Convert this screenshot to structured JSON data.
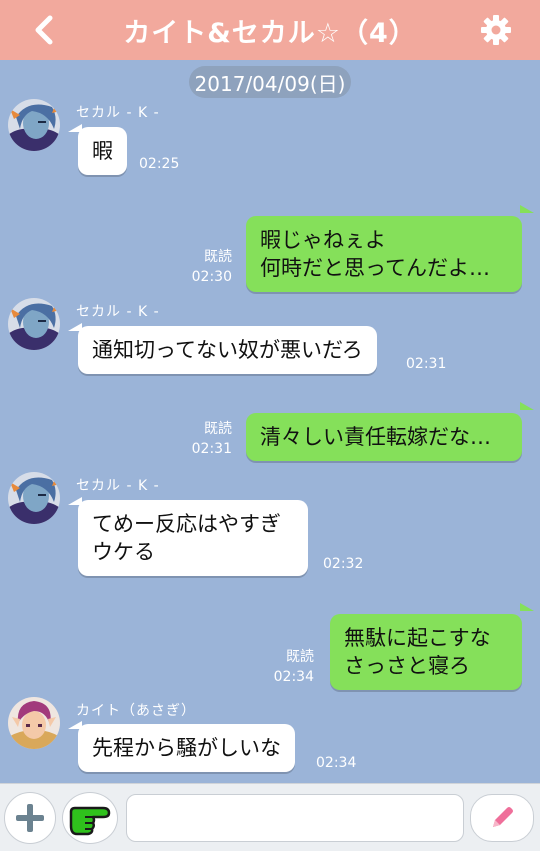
{
  "header": {
    "title": "カイト&セカル☆（4）",
    "color": "#f2a99d"
  },
  "date_label": "2017/04/09(日)",
  "messages": [
    {
      "sender": "セカル - K -",
      "lines": [
        "暇"
      ],
      "time": "02:25"
    },
    {
      "read": "既読",
      "lines": [
        "暇じゃねぇよ",
        "何時だと思ってんだよ…"
      ],
      "time": "02:30"
    },
    {
      "sender": "セカル - K -",
      "lines": [
        "通知切ってない奴が悪いだろ"
      ],
      "time": "02:31"
    },
    {
      "read": "既読",
      "lines": [
        "清々しい責任転嫁だな…"
      ],
      "time": "02:31"
    },
    {
      "sender": "セカル - K -",
      "lines": [
        "てめー反応はやすぎ",
        "ウケる"
      ],
      "time": "02:32"
    },
    {
      "read": "既読",
      "lines": [
        "無駄に起こすな",
        "さっさと寝ろ"
      ],
      "time": "02:34"
    },
    {
      "sender": "カイト（あさぎ）",
      "lines": [
        "先程から騒がしいな"
      ],
      "time": "02:34"
    }
  ],
  "composer": {
    "placeholder": ""
  },
  "icons": {
    "back": "chevron-left-icon",
    "settings": "gear-icon",
    "plus": "plus-icon",
    "stamp": "pointing-hand-icon",
    "send": "pencil-icon"
  },
  "colors": {
    "background": "#9bb4d8",
    "outgoing_bubble": "#85e05a",
    "incoming_bubble": "#ffffff"
  }
}
